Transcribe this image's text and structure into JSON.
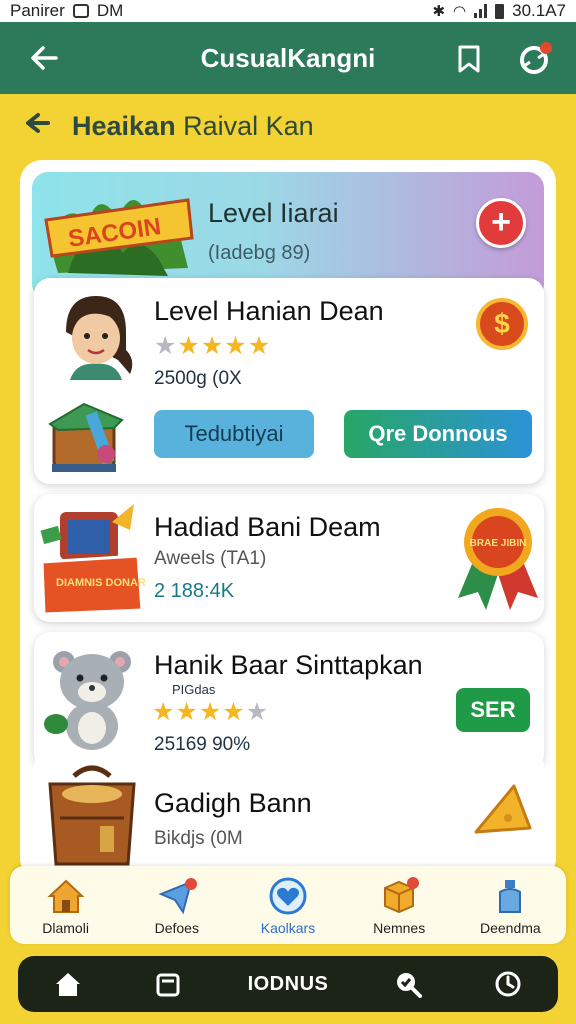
{
  "status_bar": {
    "left_text": "Panirer",
    "clock_text": "DM",
    "right_text": "30.1A7"
  },
  "app_bar": {
    "title": "CusualKangni"
  },
  "subheader": {
    "bold_text": "Heaikan",
    "rest_text": "Raival Kan"
  },
  "hero": {
    "badge_text": "SACOIN",
    "title": "Level Iiarai",
    "subtitle": "(Iadebg 89)",
    "add_symbol": "+"
  },
  "cards": [
    {
      "title": "Level Hanian Dean",
      "rating": 4,
      "meta": "2500g (0X",
      "coin_symbol": "$",
      "primary_button": "Tedubtiyai",
      "secondary_button": "Qre Donnous"
    },
    {
      "title": "Hadiad Bani Deam",
      "subtitle": "Aweels (TA1)",
      "meta": "2 188:4K",
      "badge_text": "BRAE JIBIN",
      "left_sign_text": "DIAMNIS DONAREF"
    },
    {
      "title": "Hanik Baar Sinttapkan",
      "tagline": "PIGdas",
      "rating": 4,
      "meta": "25169 90%",
      "tag": "SER"
    },
    {
      "title": "Gadigh Bann",
      "meta": "Bikdjs (0M"
    }
  ],
  "bottom_nav": [
    {
      "label": "Dlamoli",
      "icon": "home-icon",
      "active": false
    },
    {
      "label": "Defoes",
      "icon": "send-icon",
      "active": false
    },
    {
      "label": "Kaolkars",
      "icon": "heart-icon",
      "active": true
    },
    {
      "label": "Nemnes",
      "icon": "box-icon",
      "active": false
    },
    {
      "label": "Deendma",
      "icon": "bottle-icon",
      "active": false
    }
  ],
  "system_bar": {
    "center_label": "IODNUS"
  },
  "colors": {
    "app_bar": "#2d7a5a",
    "background": "#f3d233",
    "accent_red": "#e23b3b",
    "accent_green": "#1f9a47",
    "accent_blue": "#58b2dc"
  }
}
